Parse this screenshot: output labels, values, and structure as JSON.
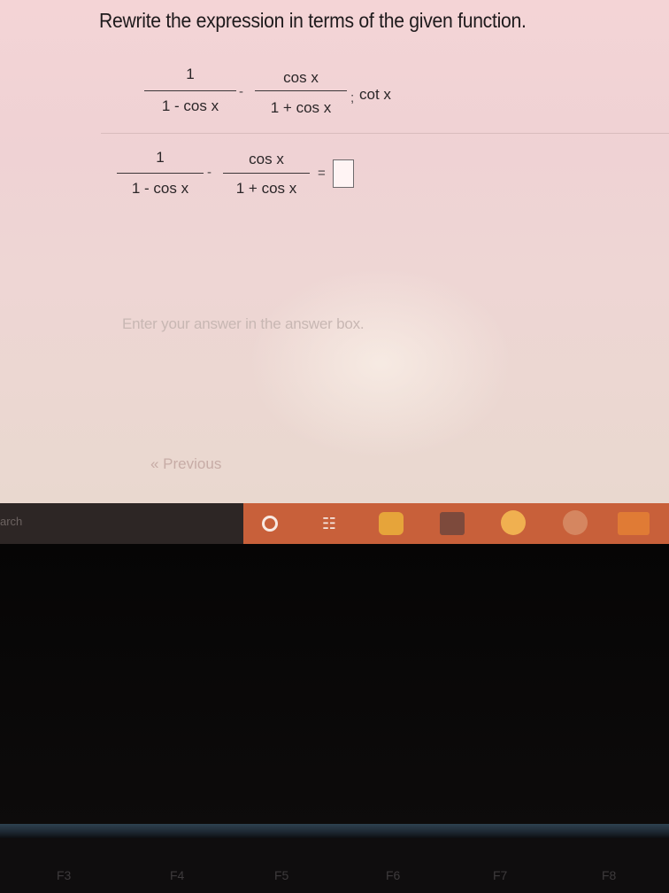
{
  "question": {
    "prompt": "Rewrite the expression in terms of the given function.",
    "given_function": "cot x"
  },
  "expression": {
    "term1_num": "1",
    "term1_den": "1 - cos x",
    "operator": "-",
    "term2_num": "cos x",
    "term2_den": "1 + cos x",
    "separator": ";"
  },
  "answer_row": {
    "term1_num": "1",
    "term1_den": "1 - cos x",
    "operator": "-",
    "term2_num": "cos x",
    "term2_den": "1 + cos x",
    "equals": "="
  },
  "hint": "Enter your answer in the answer box.",
  "previous_label": "« Previous",
  "taskbar": {
    "search_stub": "arch",
    "taskview_glyph": "☷"
  },
  "function_keys": [
    "F3",
    "F4",
    "F5",
    "F6",
    "F7",
    "F8"
  ]
}
